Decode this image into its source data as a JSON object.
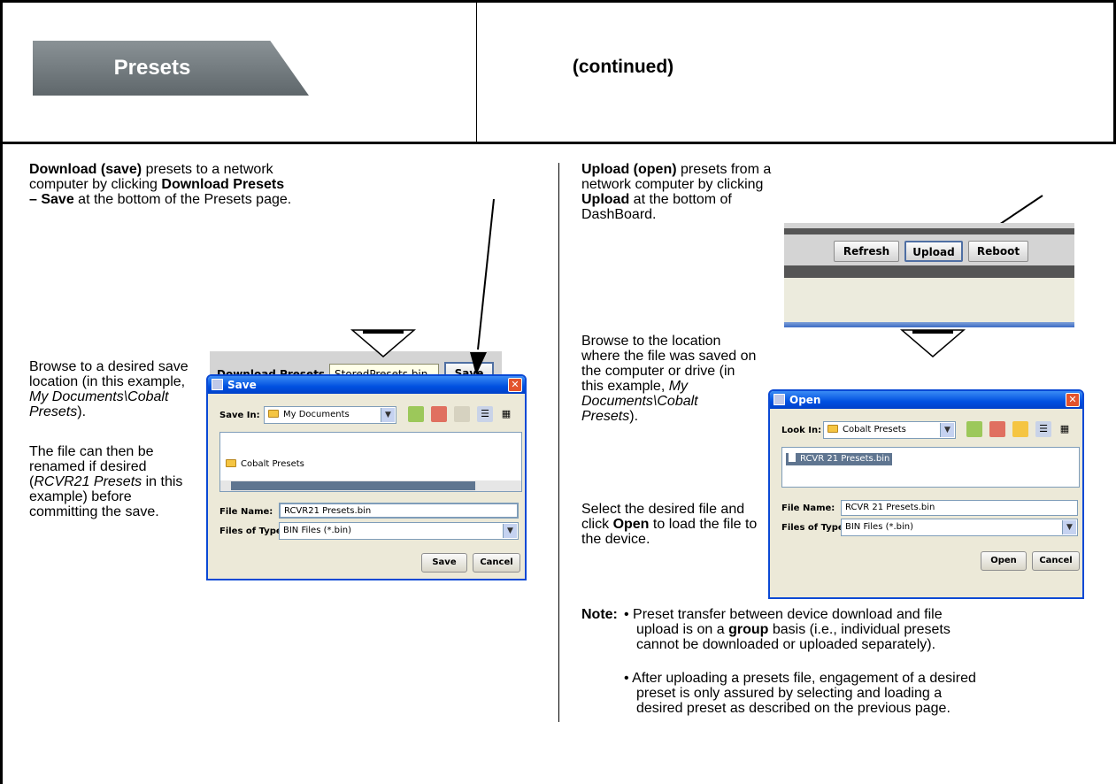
{
  "header": {
    "tab_label": "Presets",
    "continued": "(continued)"
  },
  "left": {
    "p1_bold1": "Download (save)",
    "p1_t1": " presets to a network computer by clicking ",
    "p1_bold2": "Download Presets – Save",
    "p1_t2": " at the bottom of the Presets page.",
    "p2_t1": "Browse to a desired save location (in this example, ",
    "p2_i1": "My Documents\\Cobalt Presets",
    "p2_t2": ").",
    "p3_t1": "The file can then be renamed if desired (",
    "p3_i1": "RCVR21 Presets",
    "p3_t2": " in this example) before committing the save.",
    "download_bar": {
      "label": "Download Presets",
      "field_value": "StoredPresets.bin",
      "save_button": "Save"
    },
    "dialog": {
      "title": "Save",
      "look_label": "Save In:",
      "look_value": "My Documents",
      "list_item": "Cobalt Presets",
      "file_name_label": "File Name:",
      "file_name_value": "RCVR21 Presets.bin",
      "file_type_label": "Files of Type:",
      "file_type_value": "BIN Files (*.bin)",
      "primary_button": "Save",
      "cancel_button": "Cancel"
    }
  },
  "right": {
    "p1_bold1": "Upload (open)",
    "p1_t1": " presets from a network computer by clicking ",
    "p1_bold2": "Upload",
    "p1_t2": " at the bottom of DashBoard.",
    "p2_t1": "Browse to the location where the file was saved on the computer or drive (in this example, ",
    "p2_i1": "My Documents\\Cobalt Presets",
    "p2_t2": ").",
    "p3_t1": "Select the desired file and click ",
    "p3_bold": "Open",
    "p3_t2": " to load the file to the device.",
    "upload_bar": {
      "refresh": "Refresh",
      "upload": "Upload",
      "reboot": "Reboot"
    },
    "dialog": {
      "title": "Open",
      "look_label": "Look In:",
      "look_value": "Cobalt Presets",
      "list_item": "RCVR 21 Presets.bin",
      "file_name_label": "File Name:",
      "file_name_value": "RCVR 21 Presets.bin",
      "file_type_label": "Files of Type:",
      "file_type_value": "BIN Files (*.bin)",
      "primary_button": "Open",
      "cancel_button": "Cancel"
    },
    "note": {
      "label": "Note:",
      "b1_t1": "• Preset transfer between device download and file upload is on a ",
      "b1_bold": "group",
      "b1_t2": " basis (i.e., individual presets cannot be downloaded or uploaded separately).",
      "b2": "• After uploading a presets file, engagement of a desired preset is only assured by selecting and loading a desired preset as described on the previous page."
    }
  }
}
